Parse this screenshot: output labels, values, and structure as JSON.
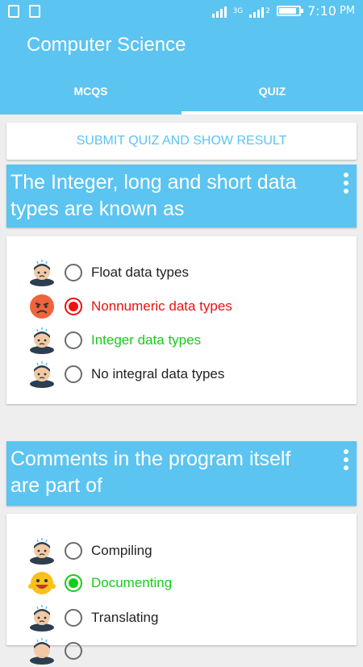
{
  "status": {
    "time": "7:10",
    "ampm": "PM",
    "network": "3G",
    "sim": "2"
  },
  "app": {
    "title": "Computer Science"
  },
  "tabs": [
    {
      "label": "MCQS"
    },
    {
      "label": "QUIZ"
    }
  ],
  "submit": {
    "label": "SUBMIT QUIZ AND SHOW RESULT"
  },
  "questions": [
    {
      "text": "The Integer, long and short data types are known as",
      "options": [
        {
          "label": "Float data types"
        },
        {
          "label": "Nonnumeric data types"
        },
        {
          "label": "Integer data types"
        },
        {
          "label": "No integral data types"
        }
      ]
    },
    {
      "text": "Comments in the program itself are part of",
      "options": [
        {
          "label": "Compiling"
        },
        {
          "label": "Documenting"
        },
        {
          "label": "Translating"
        }
      ]
    }
  ],
  "colors": {
    "accent": "#5bc4f1",
    "wrong": "#ee1111",
    "correct": "#16cc16"
  }
}
